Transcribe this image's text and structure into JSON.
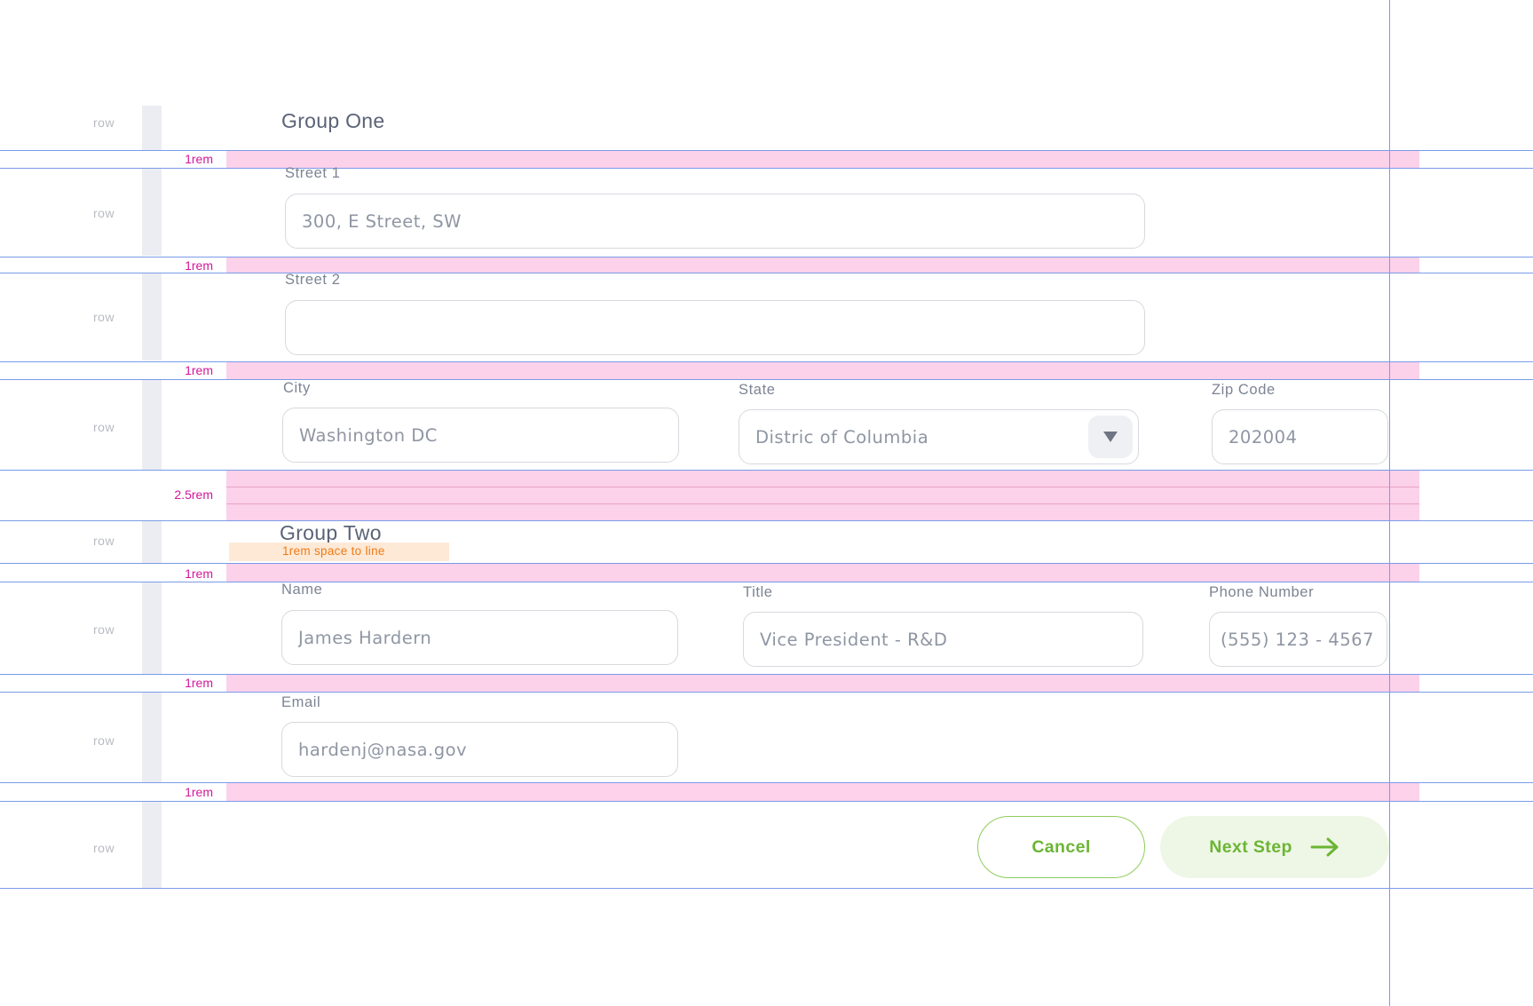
{
  "annotations": {
    "row_label": "row",
    "gap_1rem": "1rem",
    "gap_2_5rem": "2.5rem",
    "space_to_line": "1rem space to line"
  },
  "group_one": {
    "title": "Group One",
    "street1": {
      "label": "Street 1",
      "value": "300, E Street, SW"
    },
    "street2": {
      "label": "Street 2",
      "value": ""
    },
    "city": {
      "label": "City",
      "value": "Washington DC"
    },
    "state": {
      "label": "State",
      "value": "Distric of Columbia",
      "icon": "triangle-down-icon"
    },
    "zip": {
      "label": "Zip Code",
      "value": "202004"
    }
  },
  "group_two": {
    "title": "Group Two",
    "name": {
      "label": "Name",
      "value": "James Hardern"
    },
    "title_field": {
      "label": "Title",
      "value": "Vice President - R&D"
    },
    "phone": {
      "label": "Phone Number",
      "value": "(555) 123 - 4567"
    },
    "email": {
      "label": "Email",
      "value": "hardenj@nasa.gov"
    }
  },
  "actions": {
    "cancel_label": "Cancel",
    "next_label": "Next Step",
    "next_icon": "arrow-right-icon"
  },
  "colors": {
    "guide_line": "#7a9be8",
    "gap_fill": "#fcd1ea",
    "gap_text": "#d3169a",
    "accent_green": "#6cb534",
    "note_fill": "#fde9d6",
    "note_text": "#f07a16"
  }
}
